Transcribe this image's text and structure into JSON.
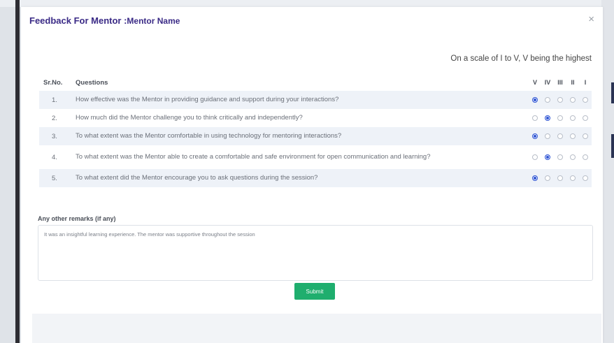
{
  "modal": {
    "title": "Feedback For Mentor :",
    "mentor_name": "Mentor Name",
    "close_icon": "×",
    "scale_note": "On a scale of I to V, V being the highest"
  },
  "table": {
    "col_sr": "Sr.No.",
    "col_questions": "Questions",
    "rating_labels": [
      "V",
      "IV",
      "III",
      "II",
      "I"
    ],
    "rows": [
      {
        "sr": "1.",
        "question": "How effective was the Mentor in providing guidance and support during your interactions?",
        "selected": "V"
      },
      {
        "sr": "2.",
        "question": "How much did the Mentor challenge you to think critically and independently?",
        "selected": "IV"
      },
      {
        "sr": "3.",
        "question": "To what extent was the Mentor comfortable in using technology for mentoring interactions?",
        "selected": "V"
      },
      {
        "sr": "4.",
        "question": "To what extent was the Mentor able to create a comfortable and safe environment for open communication and learning?",
        "selected": "IV"
      },
      {
        "sr": "5.",
        "question": "To what extent did the Mentor encourage you to ask questions during the session?",
        "selected": "V"
      }
    ]
  },
  "remarks": {
    "label": "Any other remarks (if any)",
    "value": "It was an insightful learning experience. The mentor was supportive throughout the session"
  },
  "submit_label": "Submit",
  "colors": {
    "title": "#3a2a86",
    "radio_selected": "#2f55d4",
    "submit": "#1fae6e",
    "row_shade": "#eef2f8"
  }
}
